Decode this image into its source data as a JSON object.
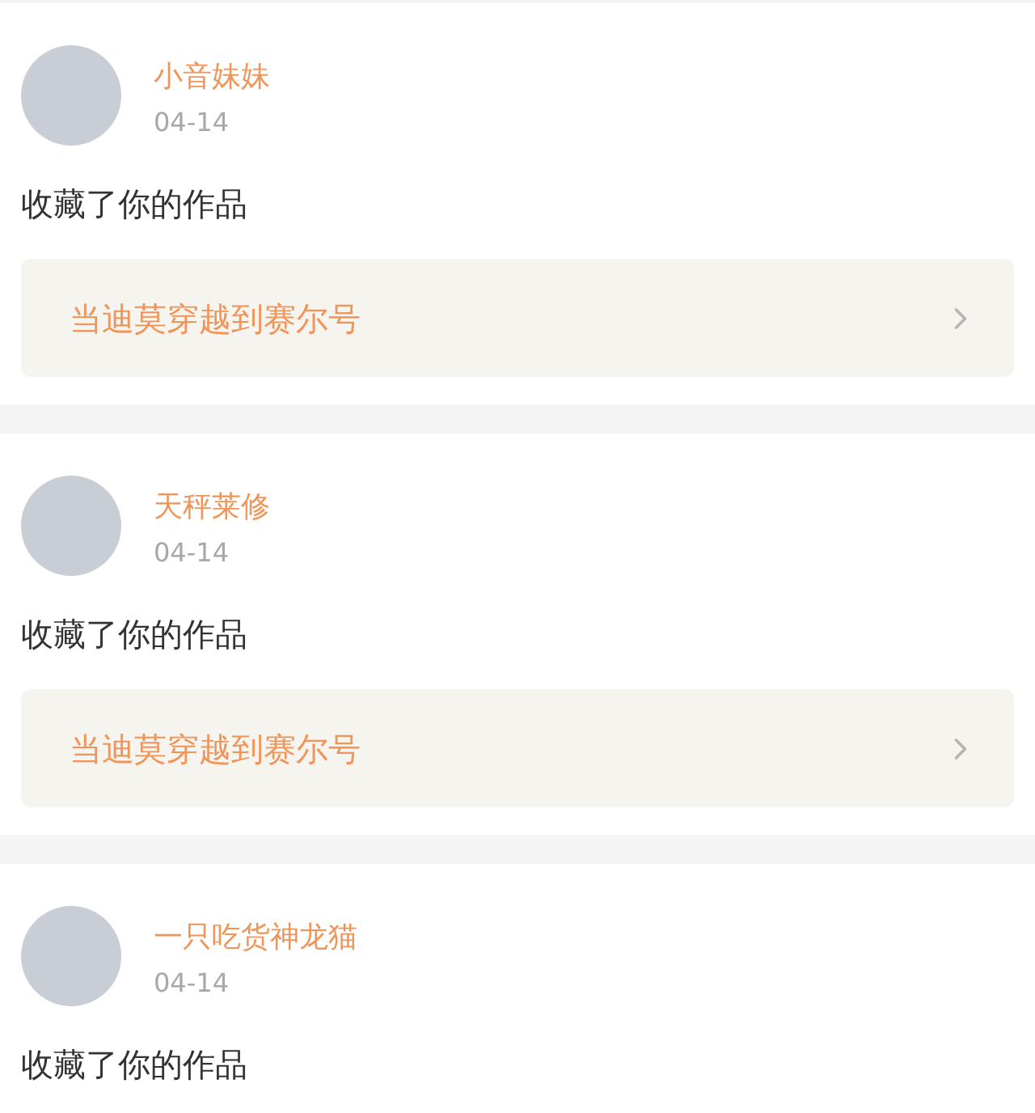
{
  "notifications": [
    {
      "user": "小音妹妹",
      "date": "04-14",
      "action": "收藏了你的作品",
      "work": "当迪莫穿越到赛尔号"
    },
    {
      "user": "天秤莱修",
      "date": "04-14",
      "action": "收藏了你的作品",
      "work": "当迪莫穿越到赛尔号"
    },
    {
      "user": "一只吃货神龙猫",
      "date": "04-14",
      "action": "收藏了你的作品"
    }
  ]
}
